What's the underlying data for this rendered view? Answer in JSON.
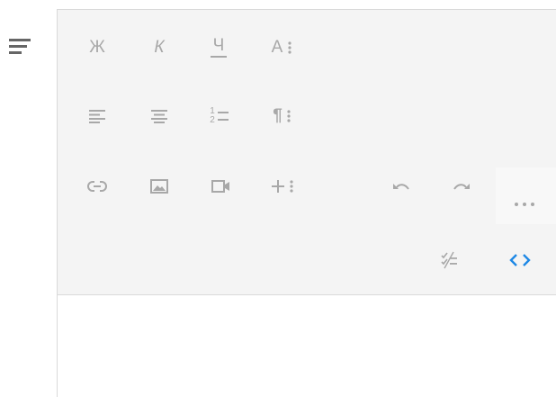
{
  "toolbar": {
    "bold_label": "Ж",
    "italic_label": "К",
    "underline_label": "Ч",
    "font_label": "A",
    "list_ordered_top": "1",
    "list_ordered_bottom": "2",
    "paragraph_label": "¶"
  },
  "icons": {
    "menu": "hamburger-icon",
    "align_left": "align-left-icon",
    "align_center": "align-center-icon",
    "link": "link-icon",
    "image": "image-icon",
    "video": "video-icon",
    "insert": "plus-icon",
    "undo": "undo-icon",
    "redo": "redo-icon",
    "more": "more-horizontal-icon",
    "spellcheck": "spellcheck-icon",
    "code": "code-view-icon"
  },
  "colors": {
    "toolbar_bg": "#f4f4f4",
    "icon": "#a8a8a8",
    "accent": "#1e88e5",
    "menu_icon": "#666666"
  }
}
